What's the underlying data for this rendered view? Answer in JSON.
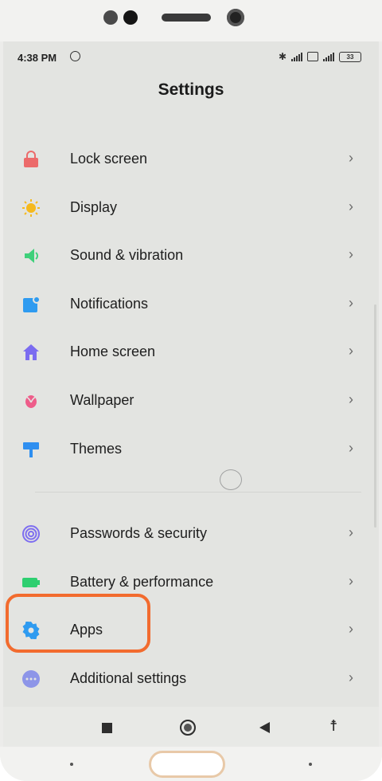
{
  "status_bar": {
    "time": "4:38 PM",
    "battery": "33"
  },
  "header": {
    "title": "Settings"
  },
  "settings_items": [
    {
      "label": "Lock screen",
      "icon": "lock-icon",
      "color": "#ec6a6a"
    },
    {
      "label": "Display",
      "icon": "sun-icon",
      "color": "#f5b91e"
    },
    {
      "label": "Sound & vibration",
      "icon": "speaker-icon",
      "color": "#3fd07a"
    },
    {
      "label": "Notifications",
      "icon": "notification-icon",
      "color": "#2f9bf0"
    },
    {
      "label": "Home screen",
      "icon": "home-icon",
      "color": "#7b6cf0"
    },
    {
      "label": "Wallpaper",
      "icon": "flower-icon",
      "color": "#ee5d8a"
    },
    {
      "label": "Themes",
      "icon": "paint-roller-icon",
      "color": "#2f8ff0"
    },
    {
      "label": "Passwords & security",
      "icon": "fingerprint-icon",
      "color": "#7e6ef0"
    },
    {
      "label": "Battery & performance",
      "icon": "battery-icon",
      "color": "#2ecf70"
    },
    {
      "label": "Apps",
      "icon": "gear-icon",
      "color": "#2f9bf0"
    },
    {
      "label": "Additional settings",
      "icon": "more-icon",
      "color": "#8d95e8"
    }
  ],
  "chevron": "›",
  "highlight_color": "#f26b2e"
}
